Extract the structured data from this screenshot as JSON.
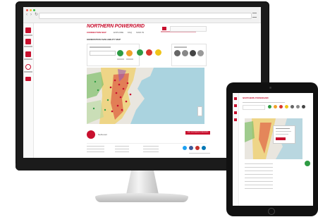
{
  "brand": {
    "name": "NORTHERN POWERGRID",
    "accent_color": "#c8102e"
  },
  "header": {
    "nav_links": [
      "CONNECTION MAP",
      "EXPLORE",
      "FAQ",
      "SIGN IN"
    ],
    "search_placeholder": ""
  },
  "page": {
    "title": "GENERATION AVAILABILITY MAP",
    "legend_title": "",
    "filter_label": ""
  },
  "toggle_circles": [
    {
      "color": "#2e9b43"
    },
    {
      "color": "#f0a12a"
    },
    {
      "color": "#d9372d"
    },
    {
      "color": "#f0c419"
    },
    {
      "color": "#666666"
    },
    {
      "color": "#888888"
    },
    {
      "color": "#444444"
    }
  ],
  "footer": {
    "logo_label": "Netheneti",
    "cta_label": "VISIT NORTHERN POWERGRID",
    "social_icons": [
      "twitter-icon",
      "facebook-icon",
      "youtube-icon",
      "linkedin-icon"
    ],
    "social_colors": [
      "#1da1f2",
      "#3b5998",
      "#c4302b",
      "#0077b5"
    ]
  },
  "browser": {
    "window_dot_colors": [
      "#f05a4f",
      "#f5bd3c",
      "#33c04a"
    ]
  }
}
